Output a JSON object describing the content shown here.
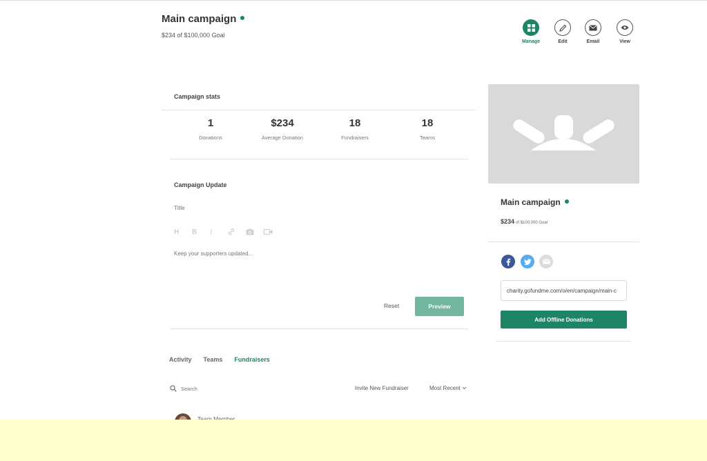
{
  "campaign": {
    "title": "Main campaign",
    "goal_line": "$234 of $100,000 Goal"
  },
  "actions": [
    {
      "label": "Manage",
      "icon": "grid-icon",
      "active": true
    },
    {
      "label": "Edit",
      "icon": "pencil-icon",
      "active": false
    },
    {
      "label": "Email",
      "icon": "envelope-icon",
      "active": false
    },
    {
      "label": "View",
      "icon": "eye-icon",
      "active": false
    }
  ],
  "stats": {
    "heading": "Campaign stats",
    "items": [
      {
        "value": "1",
        "label": "Donations"
      },
      {
        "value": "$234",
        "label": "Average Donation"
      },
      {
        "value": "18",
        "label": "Fundraisers"
      },
      {
        "value": "18",
        "label": "Teams"
      }
    ]
  },
  "update": {
    "heading": "Campaign Update",
    "title_placeholder": "Title",
    "body_placeholder": "Keep your supporters updated...",
    "toolbar": [
      "heading-icon",
      "bold-icon",
      "italic-icon",
      "link-icon",
      "camera-icon",
      "video-icon"
    ],
    "reset_label": "Reset",
    "preview_label": "Preview"
  },
  "tabs": [
    {
      "label": "Activity",
      "active": false
    },
    {
      "label": "Teams",
      "active": false
    },
    {
      "label": "Fundraisers",
      "active": true
    }
  ],
  "list": {
    "search_placeholder": "Search",
    "invite_label": "Invite New Fundraiser",
    "sort_label": "Most Recent",
    "first_member_role": "Team Member"
  },
  "sidebar": {
    "title": "Main campaign",
    "raised": "$234",
    "goal_suffix": "of $100,000 Goal",
    "share_url": "charity.gofundme.com/o/en/campaign/main-c",
    "offline_label": "Add Offline Donations",
    "social": [
      "facebook-icon",
      "twitter-icon",
      "email-share-icon"
    ]
  },
  "colors": {
    "accent": "#1e8466",
    "accent_light": "#72b5a0",
    "facebook": "#3b5998",
    "twitter": "#55acee",
    "notice_bar": "#ffffcc"
  }
}
